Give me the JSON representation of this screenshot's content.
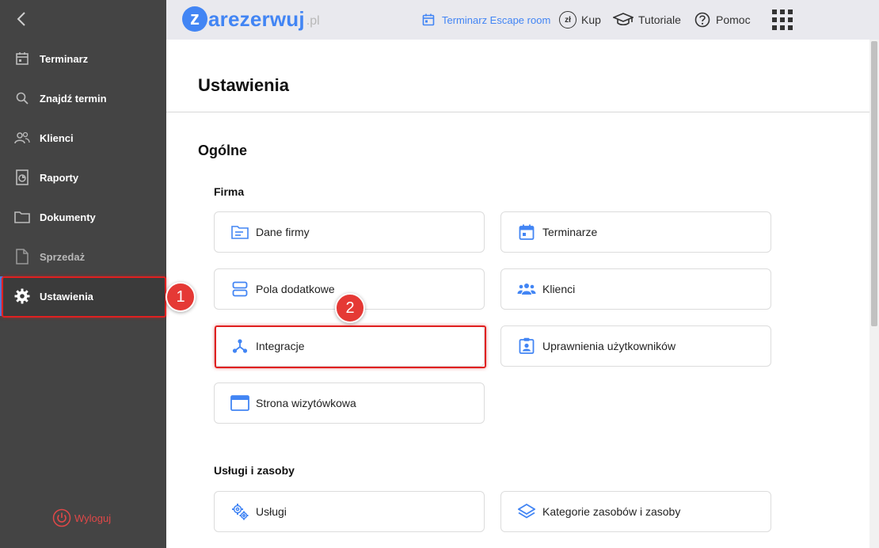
{
  "sidebar": {
    "items": [
      {
        "label": "Terminarz",
        "icon": "calendar-icon"
      },
      {
        "label": "Znajdź termin",
        "icon": "search-icon"
      },
      {
        "label": "Klienci",
        "icon": "users-icon"
      },
      {
        "label": "Raporty",
        "icon": "report-icon"
      },
      {
        "label": "Dokumenty",
        "icon": "folder-icon"
      },
      {
        "label": "Sprzedaż",
        "icon": "document-icon"
      },
      {
        "label": "Ustawienia",
        "icon": "gear-icon"
      }
    ],
    "active": "Ustawienia",
    "logout_label": "Wyloguj"
  },
  "topbar": {
    "logo_initial": "z",
    "logo_text": "arezerwuj",
    "logo_tld": ".pl",
    "calendar_link": "Terminarz Escape room",
    "buy_label": "Kup",
    "buy_icon_text": "zł",
    "tutorials_label": "Tutoriale",
    "help_label": "Pomoc"
  },
  "page": {
    "title": "Ustawienia",
    "section_title": "Ogólne"
  },
  "firma": {
    "title": "Firma",
    "cards": [
      {
        "label": "Dane firmy",
        "icon": "company-data-icon"
      },
      {
        "label": "Terminarze",
        "icon": "calendar-icon"
      },
      {
        "label": "Pola dodatkowe",
        "icon": "fields-icon"
      },
      {
        "label": "Klienci",
        "icon": "clients-icon"
      },
      {
        "label": "Integracje",
        "icon": "integration-icon"
      },
      {
        "label": "Uprawnienia użytkowników",
        "icon": "user-permissions-icon"
      },
      {
        "label": "Strona wizytówkowa",
        "icon": "web-page-icon"
      }
    ]
  },
  "uslugi": {
    "title": "Usługi i zasoby",
    "cards": [
      {
        "label": "Usługi",
        "icon": "services-icon"
      },
      {
        "label": "Kategorie zasobów i zasoby",
        "icon": "layers-icon"
      }
    ]
  },
  "annotations": [
    {
      "number": "1",
      "target": "Ustawienia"
    },
    {
      "number": "2",
      "target": "Integracje"
    }
  ],
  "colors": {
    "accent": "#4285f4",
    "sidebar_bg": "#444444",
    "highlight": "#e02020",
    "badge": "#e53935",
    "logout": "#e04848"
  }
}
